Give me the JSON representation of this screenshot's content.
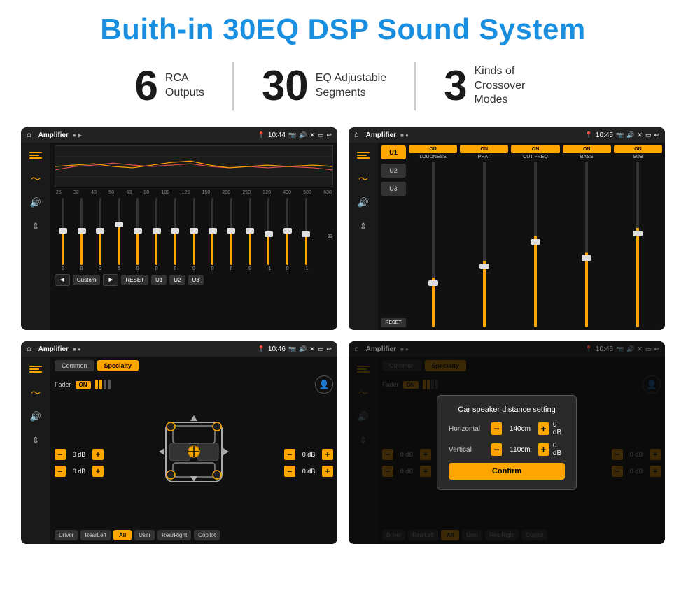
{
  "header": {
    "title": "Buith-in 30EQ DSP Sound System"
  },
  "stats": [
    {
      "number": "6",
      "label_line1": "RCA",
      "label_line2": "Outputs"
    },
    {
      "number": "30",
      "label_line1": "EQ Adjustable",
      "label_line2": "Segments"
    },
    {
      "number": "3",
      "label_line1": "Kinds of",
      "label_line2": "Crossover Modes"
    }
  ],
  "screens": {
    "eq_screen": {
      "status_title": "Amplifier",
      "time": "10:44",
      "freq_labels": [
        "25",
        "32",
        "40",
        "50",
        "63",
        "80",
        "100",
        "125",
        "160",
        "200",
        "250",
        "320",
        "400",
        "500",
        "630"
      ],
      "values": [
        "0",
        "0",
        "0",
        "5",
        "0",
        "0",
        "0",
        "0",
        "0",
        "0",
        "0",
        "-1",
        "0",
        "-1"
      ],
      "preset": "Custom",
      "buttons": [
        "RESET",
        "U1",
        "U2",
        "U3"
      ]
    },
    "crossover_screen": {
      "status_title": "Amplifier",
      "time": "10:45",
      "presets": [
        "U1",
        "U2",
        "U3"
      ],
      "channels": [
        {
          "on": true,
          "label": "LOUDNESS"
        },
        {
          "on": true,
          "label": "PHAT"
        },
        {
          "on": true,
          "label": "CUT FREQ"
        },
        {
          "on": true,
          "label": "BASS"
        },
        {
          "on": true,
          "label": "SUB"
        }
      ],
      "reset_label": "RESET"
    },
    "speaker_screen": {
      "status_title": "Amplifier",
      "time": "10:46",
      "tabs": [
        "Common",
        "Specialty"
      ],
      "active_tab": "Specialty",
      "fader_label": "Fader",
      "fader_on": "ON",
      "controls_left": [
        {
          "value": "0 dB"
        },
        {
          "value": "0 dB"
        }
      ],
      "controls_right": [
        {
          "value": "0 dB"
        },
        {
          "value": "0 dB"
        }
      ],
      "bottom_buttons": [
        "Driver",
        "RearLeft",
        "All",
        "User",
        "RearRight",
        "Copilot"
      ]
    },
    "dialog_screen": {
      "status_title": "Amplifier",
      "time": "10:46",
      "tabs": [
        "Common",
        "Specialty"
      ],
      "dialog_title": "Car speaker distance setting",
      "horizontal_label": "Horizontal",
      "horizontal_value": "140cm",
      "vertical_label": "Vertical",
      "vertical_value": "110cm",
      "db_values": [
        "0 dB",
        "0 dB"
      ],
      "confirm_label": "Confirm"
    }
  }
}
